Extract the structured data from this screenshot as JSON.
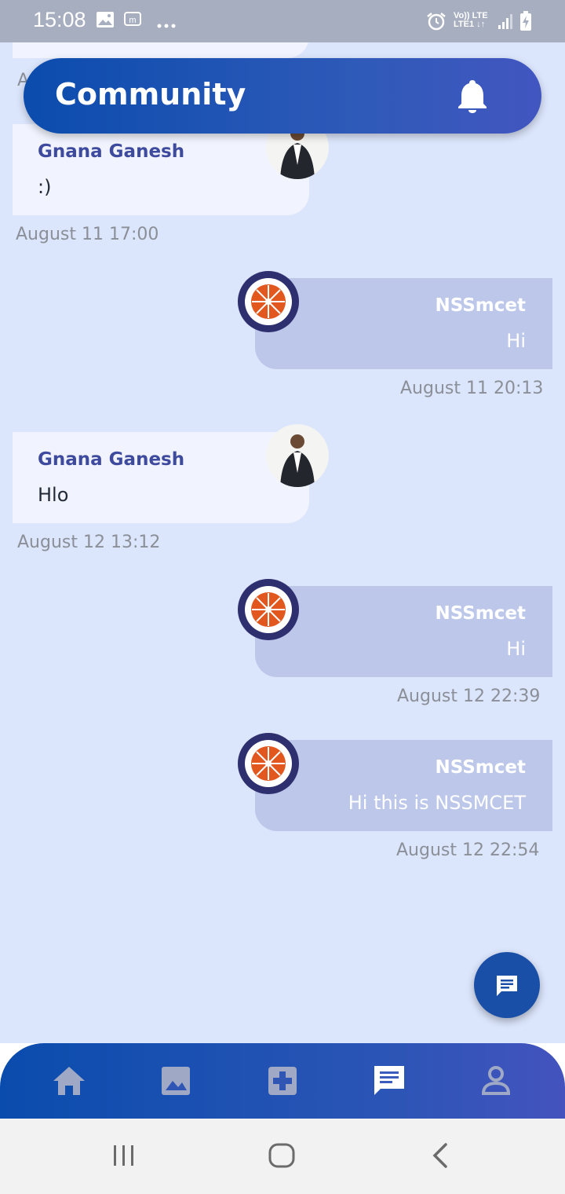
{
  "status_bar": {
    "time": "15:08",
    "icons": [
      "gallery-icon",
      "m-icon",
      "more-dots-icon",
      "alarm-icon",
      "volte-icon",
      "lte-icon",
      "signal-icon",
      "battery-charging-icon"
    ],
    "net_top": "Vo)) LTE",
    "net_bottom": "LTE1 ↓↑"
  },
  "header": {
    "title": "Community",
    "icon": "bell-icon"
  },
  "messages": [
    {
      "direction": "incoming",
      "sender": "Gnana Ganesh",
      "text": ":)",
      "timestamp": "August 11  17:00"
    },
    {
      "direction": "outgoing",
      "sender": "NSSmcet",
      "text": "Hi",
      "timestamp": "August 11  20:13"
    },
    {
      "direction": "incoming",
      "sender": "Gnana Ganesh",
      "text": "Hlo",
      "timestamp": "August 12  13:12"
    },
    {
      "direction": "outgoing",
      "sender": "NSSmcet",
      "text": "Hi",
      "timestamp": "August 12  22:39"
    },
    {
      "direction": "outgoing",
      "sender": "NSSmcet",
      "text": "Hi this is NSSMCET",
      "timestamp": "August 12  22:54"
    }
  ],
  "partial_timestamp": "A",
  "fab": {
    "icon": "message-icon"
  },
  "bottom_nav": {
    "items": [
      {
        "name": "home",
        "icon": "home-icon",
        "active": false
      },
      {
        "name": "gallery",
        "icon": "image-icon",
        "active": false
      },
      {
        "name": "health",
        "icon": "medical-cross-icon",
        "active": false
      },
      {
        "name": "community",
        "icon": "chat-icon",
        "active": true
      },
      {
        "name": "profile",
        "icon": "person-icon",
        "active": false
      }
    ]
  },
  "system_nav": [
    "recents-icon",
    "home-circle-icon",
    "back-icon"
  ],
  "colors": {
    "background": "#dbe5fb",
    "header_gradient_start": "#0b4cad",
    "header_gradient_end": "#4256c0",
    "incoming_bubble": "#f1f4fe",
    "outgoing_bubble": "#bcc7ea",
    "sender_name": "#3d4a9e",
    "timestamp": "#8b8f98",
    "nav_inactive": "#9fa8c4",
    "nav_active": "#ffffff"
  }
}
